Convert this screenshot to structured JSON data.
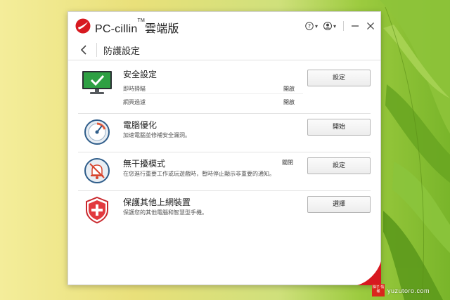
{
  "app": {
    "title": "PC-cillin",
    "trademark": "TM",
    "edition": "雲端版"
  },
  "nav": {
    "title": "防護設定"
  },
  "rows": [
    {
      "title": "安全設定",
      "icon": "monitor-check-icon",
      "items": [
        {
          "label": "即時掃瞄",
          "value": "開啟"
        },
        {
          "label": "網頁過濾",
          "value": "開啟"
        }
      ],
      "button": "設定"
    },
    {
      "title": "電腦優化",
      "icon": "speedometer-icon",
      "description": "加速電腦並修補安全漏洞。",
      "button": "開始"
    },
    {
      "title": "無干擾模式",
      "icon": "mute-bell-icon",
      "status": "關閉",
      "description": "在您進行重要工作或玩遊戲時，暫時停止顯示非重要的通知。",
      "button": "設定"
    },
    {
      "title": "保護其他上網裝置",
      "icon": "shield-plus-icon",
      "description": "保護您的其他電腦和智慧型手機。",
      "button": "選擇"
    }
  ],
  "watermark": {
    "text": "yuzutoro.com",
    "badge": "柚子 情報"
  },
  "colors": {
    "brand_red": "#d71920",
    "monitor_green": "#2ea043",
    "icon_blue": "#2f5d8a"
  }
}
